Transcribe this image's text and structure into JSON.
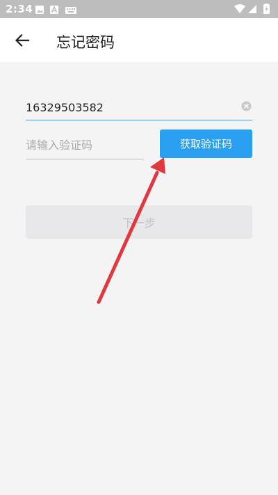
{
  "status_bar": {
    "time": "2:34",
    "left_icons": [
      "image-icon",
      "text-a-icon",
      "keyboard-icon"
    ],
    "right_icons": [
      "wifi-icon",
      "signal-icon",
      "battery-charging-icon"
    ]
  },
  "header": {
    "title": "忘记密码",
    "back_icon": "arrow-left-icon"
  },
  "form": {
    "phone_value": "16329503582",
    "code_placeholder": "请输入验证码",
    "get_code_label": "获取验证码",
    "next_label": "下一步"
  },
  "colors": {
    "accent": "#2b9ff0",
    "annotation_arrow": "#e0383e",
    "status_bar": "#bdbdbd",
    "disabled_button": "#e8e8ea"
  }
}
